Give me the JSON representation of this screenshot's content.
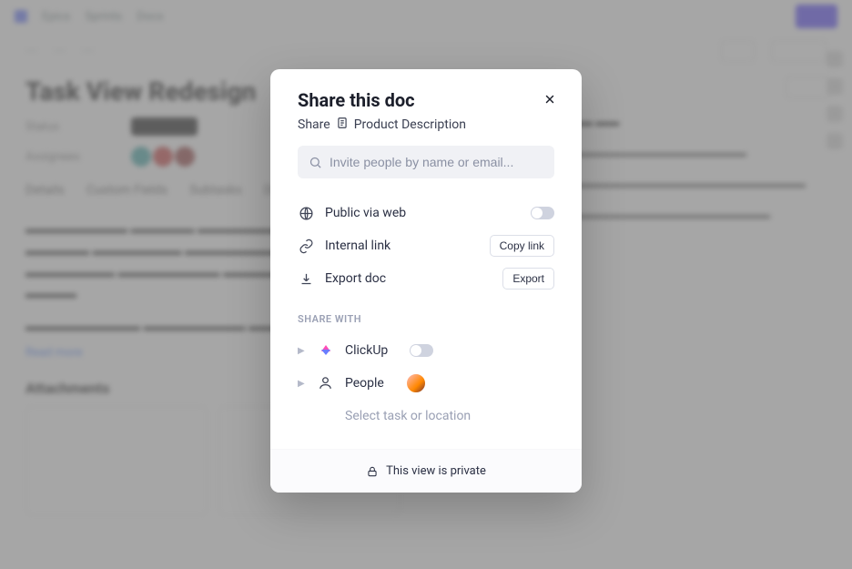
{
  "modal": {
    "title": "Share this doc",
    "sub_prefix": "Share",
    "doc_name": "Product Description",
    "search_placeholder": "Invite people by name or email...",
    "options": {
      "public": "Public via web",
      "internal": "Internal link",
      "export": "Export doc",
      "copy_btn": "Copy link",
      "export_btn": "Export"
    },
    "section_label": "SHARE WITH",
    "share": {
      "clickup": "ClickUp",
      "people": "People",
      "select_loc": "Select task or location"
    },
    "footer": "This view is private"
  },
  "bg": {
    "topbar": {
      "a": "Epics",
      "b": "Sprints",
      "c": "Docs"
    },
    "title": "Task View Redesign",
    "meta": {
      "status": "Status",
      "assignees": "Assignees"
    },
    "tabs": {
      "t1": "Details",
      "t2": "Custom Fields",
      "t3": "Subtasks",
      "t4": "Docs"
    },
    "readmore": "Read more",
    "attachments": "Attachments"
  }
}
